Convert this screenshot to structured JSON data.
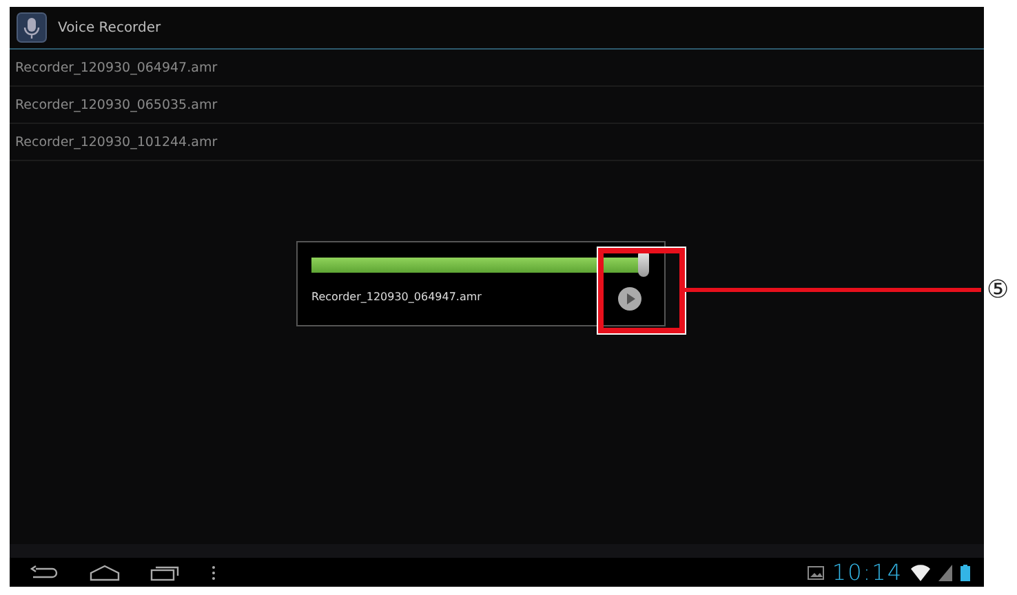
{
  "app_bar": {
    "title": "Voice Recorder"
  },
  "recordings": [
    {
      "name": "Recorder_120930_064947.amr"
    },
    {
      "name": "Recorder_120930_065035.amr"
    },
    {
      "name": "Recorder_120930_101244.amr"
    }
  ],
  "player": {
    "file": "Recorder_120930_064947.amr",
    "level": 0.98
  },
  "status_bar": {
    "time": "10:14"
  },
  "callout": {
    "label": "⑤"
  }
}
